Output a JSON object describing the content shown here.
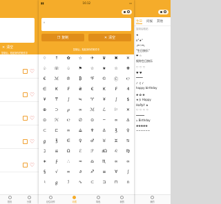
{
  "status": {
    "time": "16:12"
  },
  "left_panel": {
    "clear_label": "清空",
    "hint": "复制后，粘贴到你的软件中"
  },
  "main": {
    "input_text": "。",
    "copy_label": "复制",
    "clear_label": "清空",
    "hint": "复制后，粘贴到你的软件中",
    "symbols": [
      "♢",
      "↑",
      "✿",
      "☆",
      "✈",
      "♛",
      "✖",
      "✕",
      "♤",
      "☏",
      "♤",
      "⚑",
      "☆",
      "★",
      "☆",
      "❋",
      "€",
      "ℳ",
      "℗",
      "₿",
      "℉",
      "©",
      "Ⓒ",
      "℮",
      "∈",
      "₭",
      "₣",
      "₴",
      "€",
      "₭",
      "₣",
      "₰",
      "¥",
      "₸",
      "∫",
      "≒",
      "♈",
      "¥",
      "∫",
      "$",
      "⊕",
      "⊃",
      "℘",
      "∞",
      "ℳ",
      "ℒ",
      "⚐",
      "✕",
      "⊙",
      "ℋ",
      "℮",
      "∅",
      "⊙",
      "⌔",
      "∞",
      "⚓",
      "⊂",
      "⊏",
      "∞",
      "⟁",
      "♆",
      "⚓",
      "℥",
      "♀",
      "ℊ",
      "℥",
      "∈",
      "♀",
      "♂",
      "♉",
      "♊",
      "♋",
      "ℷ",
      "≌",
      "Ω",
      "ℰ",
      "ℱ",
      "ℲΩ",
      "♌",
      "♍",
      "∗",
      "∱",
      "∴",
      "≂",
      "♎",
      "♏",
      "∞",
      "∞",
      "§",
      "√",
      "∞",
      "∂",
      "♐",
      "≡",
      "∀",
      "∫",
      "♮",
      "ℊ",
      "ℐ",
      "∿",
      "⊂",
      "⊐",
      "⊓",
      "∩"
    ]
  },
  "nav": [
    "首页",
    "分类",
    "记住动作",
    "收藏",
    "特色",
    "我的"
  ],
  "right_panel": {
    "tabs": [
      "生日",
      "问候",
      "其他"
    ],
    "active_tab": "生日",
    "search_placeholder": "复制后粘贴",
    "lines": [
      "★",
      "o°★°",
      "╭═☆═╮",
      "\"生日快乐\"",
      "❤ ☆",
      "祝你生日快乐",
      "",
      "♡ ♡ ♡",
      "♥ ♥",
      "━━━━",
      "♪ ♫ ♪",
      "happy birthday",
      "",
      "❀ ✿ ❀",
      "★彡 Happy",
      "HaPpY ★",
      "♡ ♡ ♡ ♡",
      "━━━━━",
      "ঌ Birthday",
      "❀❀❀❀❀",
      "~~~~~~"
    ]
  },
  "colors": {
    "accent": "#f5ac2a",
    "button": "#e08d1a",
    "heart": "#e4564a"
  }
}
